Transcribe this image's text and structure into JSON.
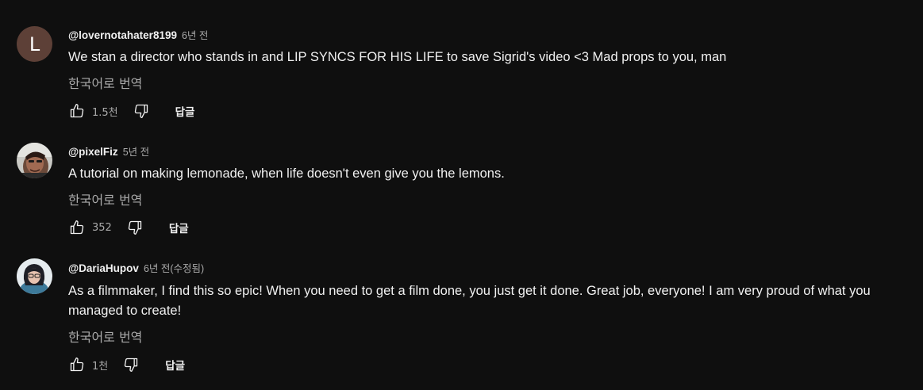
{
  "comments": [
    {
      "avatar_letter": "L",
      "author": "@lovernotahater8199",
      "time": "6년 전",
      "edited": "",
      "text": "We stan a director who stands in and LIP SYNCS FOR HIS LIFE to save Sigrid's video <3 Mad props to you, man",
      "translate": "한국어로 번역",
      "likes": "1.5천",
      "reply": "답글",
      "avatar_color": "#5d4037"
    },
    {
      "avatar_letter": "",
      "author": "@pixelFiz",
      "time": "5년 전",
      "edited": "",
      "text": "A tutorial on making lemonade, when life doesn't even give you the lemons.",
      "translate": "한국어로 번역",
      "likes": "352",
      "reply": "답글"
    },
    {
      "avatar_letter": "",
      "author": "@DariaHupov",
      "time": "6년 전",
      "edited": "(수정됨)",
      "text": "As a filmmaker, I find this so epic! When you need to get a film done, you just get it done. Great job, everyone! I am very proud of what you managed to create!",
      "translate": "한국어로 번역",
      "likes": "1천",
      "reply": "답글"
    }
  ],
  "icons": {
    "like": "thumbs-up-icon",
    "dislike": "thumbs-down-icon"
  },
  "colors": {
    "background": "#0f0f0f",
    "text": "#f1f1f1",
    "secondary": "#aaaaaa"
  }
}
